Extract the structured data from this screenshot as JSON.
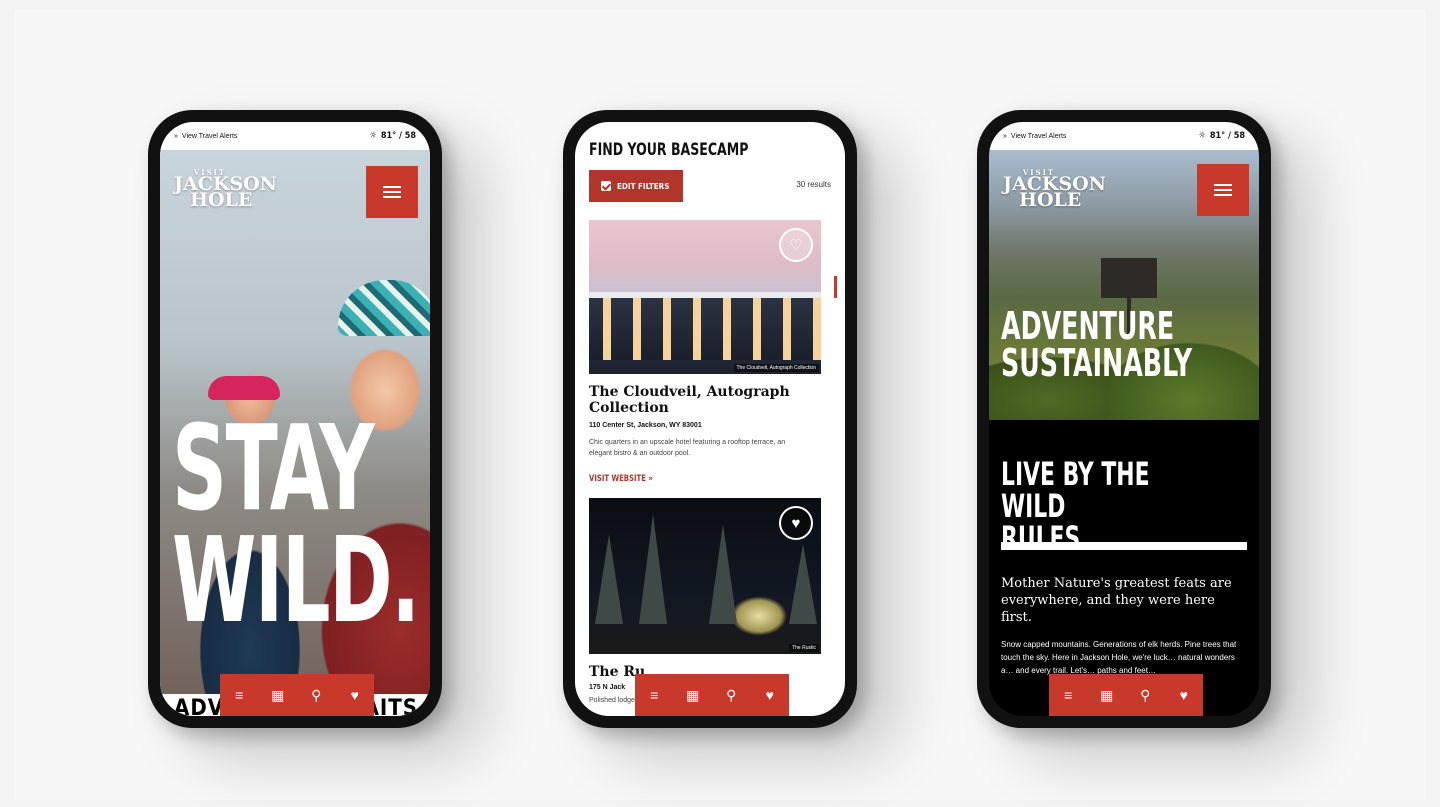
{
  "status_bar": {
    "alerts_label": "View Travel Alerts",
    "weather": "81° / 58"
  },
  "logo": {
    "line1": "VISIT",
    "line2": "JACKSON",
    "line3": "HOLE"
  },
  "phone1": {
    "headline_line1": "STAY",
    "headline_line2": "WILD.",
    "next_section": "ADVENTURE AWAITS"
  },
  "phone2": {
    "title": "FIND YOUR BASECAMP",
    "filter_button": "EDIT FILTERS",
    "results_count": "30 results",
    "listings": [
      {
        "name": "The Cloudveil, Autograph Collection",
        "address": "110 Center St, Jackson, WY 83001",
        "description": "Chic quarters in an upscale hotel featuring a rooftop terrace, an elegant bistro & an outdoor pool.",
        "link": "VISIT WEBSITE",
        "photo_credit": "The Cloudveil, Autograph Collection"
      },
      {
        "name": "The Ru",
        "address": "175 N Jack",
        "description": "Polished lodge",
        "photo_credit": "The Rustic"
      }
    ]
  },
  "phone3": {
    "hero_line1": "ADVENTURE",
    "hero_line2": "SUSTAINABLY",
    "section_title_line1": "LIVE BY THE WILD",
    "section_title_line2": "RULES.",
    "intro": "Mother Nature's greatest feats are everywhere, and they were here first.",
    "body": "Snow capped mountains. Generations of elk herds. Pine trees that touch the sky. Here in Jackson Hole, we're luck… natural wonders a… and every trail. Let's… paths and feet…"
  },
  "bottom_nav_icons": [
    "menu-icon",
    "calendar-icon",
    "search-icon",
    "heart-icon"
  ],
  "colors": {
    "brand_red": "#c8392b",
    "dark": "#000000"
  }
}
